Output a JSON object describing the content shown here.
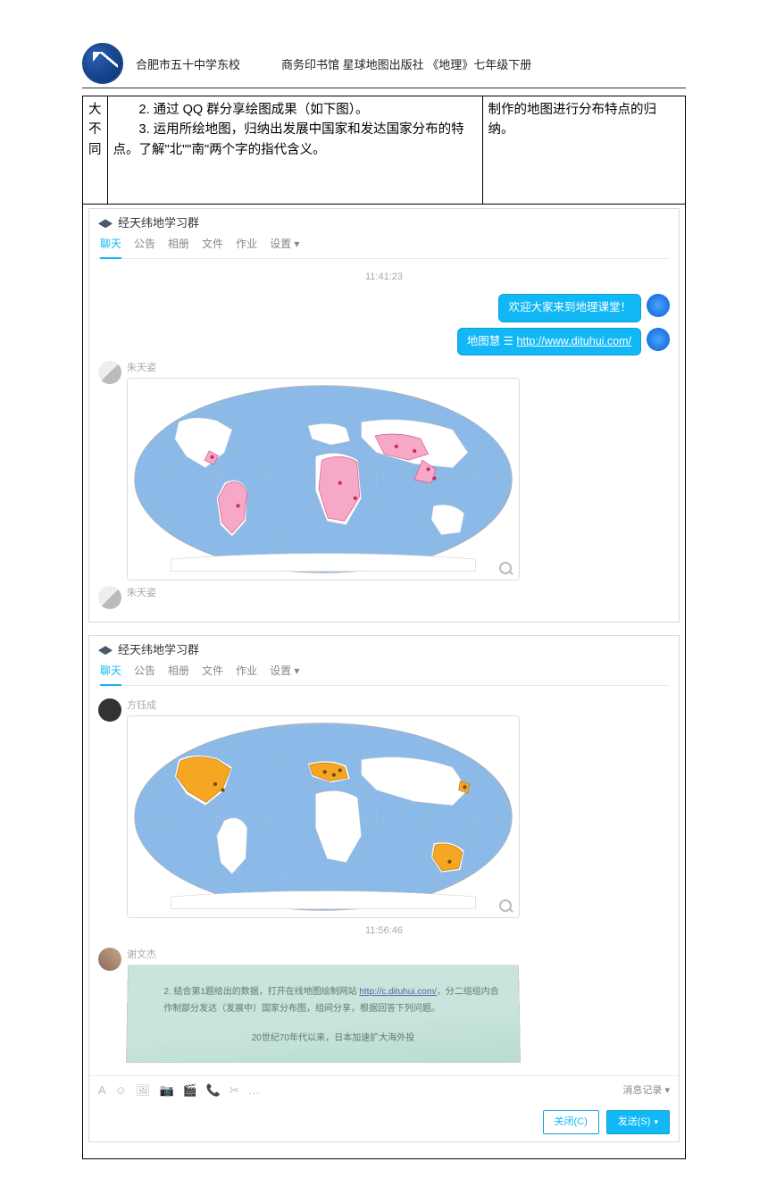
{
  "header": {
    "school": "合肥市五十中学东校",
    "publisher": "商务印书馆 星球地图出版社 《地理》七年级下册"
  },
  "table": {
    "row_label": {
      "c1": "大",
      "c2": "不",
      "c3": "同"
    },
    "main": {
      "line2": "2. 通过 QQ 群分享绘图成果（如下图）。",
      "line3": "3. 运用所绘地图，归纳出发展中国家和发达国家分布的特点。了解\"北\"\"南\"两个字的指代含义。"
    },
    "right": "制作的地图进行分布特点的归纳。"
  },
  "chat": {
    "group_name": "经天纬地学习群",
    "tabs": [
      "聊天",
      "公告",
      "相册",
      "文件",
      "作业",
      "设置"
    ],
    "settings_caret": " ▾",
    "time1": "11:41:23",
    "time2": "11:56:46",
    "msg_welcome": "欢迎大家来到地理课堂！",
    "msg_link_prefix": "地图慧 ",
    "msg_link_icon": "☰",
    "msg_link_url": "http://www.dituhui.com/",
    "user1": "朱天姿",
    "user2": "方钰成",
    "user3": "谢文杰",
    "photo_text1": "2. 结合第1题给出的数据，打开在线地图绘制网站 ",
    "photo_link": "http://c.dituhui.com/",
    "photo_text1b": "，分二组组内合作制部分发达（发展中）国家分布图，组间分享，根据回答下列问题。",
    "photo_text2": "20世纪70年代以来，日本加速扩大海外投",
    "toolbar": {
      "i1": "A",
      "i2": "☺",
      "i3": "🖼",
      "i4": "📷",
      "i5": "🎬",
      "i6": "📞",
      "i7": "✂",
      "i8": "…"
    },
    "record": "消息记录 ▾",
    "close_btn": "关闭(C)",
    "send_btn": "发送(S)"
  }
}
